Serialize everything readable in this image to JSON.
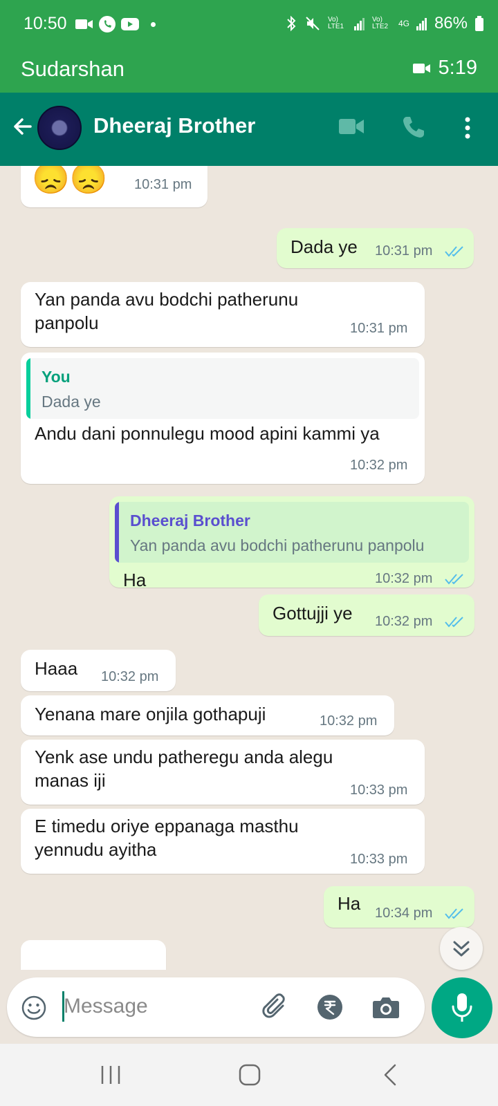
{
  "status_bar": {
    "time": "10:50",
    "lte1": "Vo) LTE1",
    "lte2": "Vo) LTE2",
    "network_4g": "4G",
    "battery": "86%"
  },
  "call_banner": {
    "name": "Sudarshan",
    "timer": "5:19"
  },
  "header": {
    "contact_name": "Dheeraj Brother"
  },
  "messages": [
    {
      "direction": "in",
      "text": "😞😞",
      "time": "10:31 pm"
    },
    {
      "direction": "out",
      "text": "Dada ye",
      "time": "10:31 pm",
      "status": "read"
    },
    {
      "direction": "in",
      "text": "Yan panda avu bodchi patherunu panpolu",
      "time": "10:31 pm"
    },
    {
      "direction": "in",
      "quote": {
        "name": "You",
        "text": "Dada ye"
      },
      "text": "Andu dani ponnulegu mood apini kammi ya",
      "time": "10:32 pm"
    },
    {
      "direction": "out",
      "quote": {
        "name": "Dheeraj Brother",
        "text": "Yan panda avu bodchi patherunu panpolu"
      },
      "text": "Ha",
      "time": "10:32 pm",
      "status": "read"
    },
    {
      "direction": "out",
      "text": "Gottujji ye",
      "time": "10:32 pm",
      "status": "read"
    },
    {
      "direction": "in",
      "text": "Haaa",
      "time": "10:32 pm"
    },
    {
      "direction": "in",
      "text": "Yenana mare onjila gothapuji",
      "time": "10:32 pm"
    },
    {
      "direction": "in",
      "text": "Yenk ase undu patheregu anda alegu manas iji",
      "time": "10:33 pm"
    },
    {
      "direction": "in",
      "text": "E timedu oriye eppanaga masthu yennudu ayitha",
      "time": "10:33 pm"
    },
    {
      "direction": "out",
      "text": "Ha",
      "time": "10:34 pm",
      "status": "read"
    }
  ],
  "input": {
    "placeholder": "Message"
  },
  "colors": {
    "header": "#008069",
    "status_bar": "#2ea44f",
    "outgoing_bubble": "#e2fccf",
    "incoming_bubble": "#ffffff",
    "read_ticks": "#53bdeb",
    "mic_button": "#00a884"
  }
}
